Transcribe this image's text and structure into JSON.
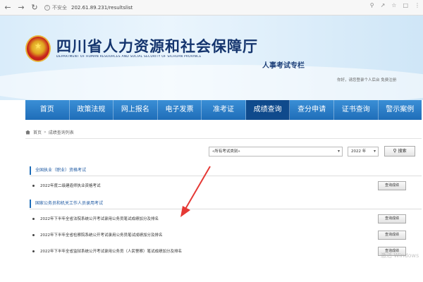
{
  "browser": {
    "security_label": "不安全",
    "url": "202.61.89.231/resultslist"
  },
  "header": {
    "site_title": "四川省人力资源和社会保障厅",
    "site_title_en": "DEPARTMENT OF HUMAN RESOURCES AND SOCIAL SECURITY OF SICHUAN PROVINCE",
    "sub_title": "人事考试专栏",
    "user_bar": "你好，请您登录个人后台  免费注册"
  },
  "nav": {
    "items": [
      "首页",
      "政策法规",
      "网上报名",
      "电子发票",
      "准考证",
      "成绩查询",
      "查分申请",
      "证书查询",
      "警示案例"
    ],
    "active_index": 5
  },
  "breadcrumb": {
    "home": "首页",
    "separator": "»",
    "current": "成绩查询列表"
  },
  "search": {
    "type_value": "«所有考试类别»",
    "year_value": "2022 年",
    "button_label": "搜索"
  },
  "sections": [
    {
      "title": "全国执业（职业）资格考试",
      "rows": [
        {
          "text": "2022年度二级建造师执业资格考试",
          "button": "查询成绩"
        }
      ]
    },
    {
      "title": "国家公务员和机关工作人员录用考试",
      "rows": [
        {
          "text": "2022年下半年全省法院系统公开考试录用公务员笔试成绩加分及排名",
          "button": "查询成绩"
        },
        {
          "text": "2022年下半年全省检察院系统公开考试录用公务员笔试成绩加分及排名",
          "button": "查询成绩"
        },
        {
          "text": "2022年下半年全省监狱系统公开考试录用公务员（人民警察）笔试成绩加分及排名",
          "button": "查询成绩"
        }
      ]
    }
  ],
  "watermark": "激活 Windows",
  "colors": {
    "nav_blue": "#1f6db8",
    "nav_active": "#0f4a8c",
    "title_navy": "#15356e",
    "annotation_arrow": "#e53935"
  },
  "icons": {
    "emblem": "national-emblem-icon",
    "home": "home-icon",
    "search": "search-icon"
  }
}
